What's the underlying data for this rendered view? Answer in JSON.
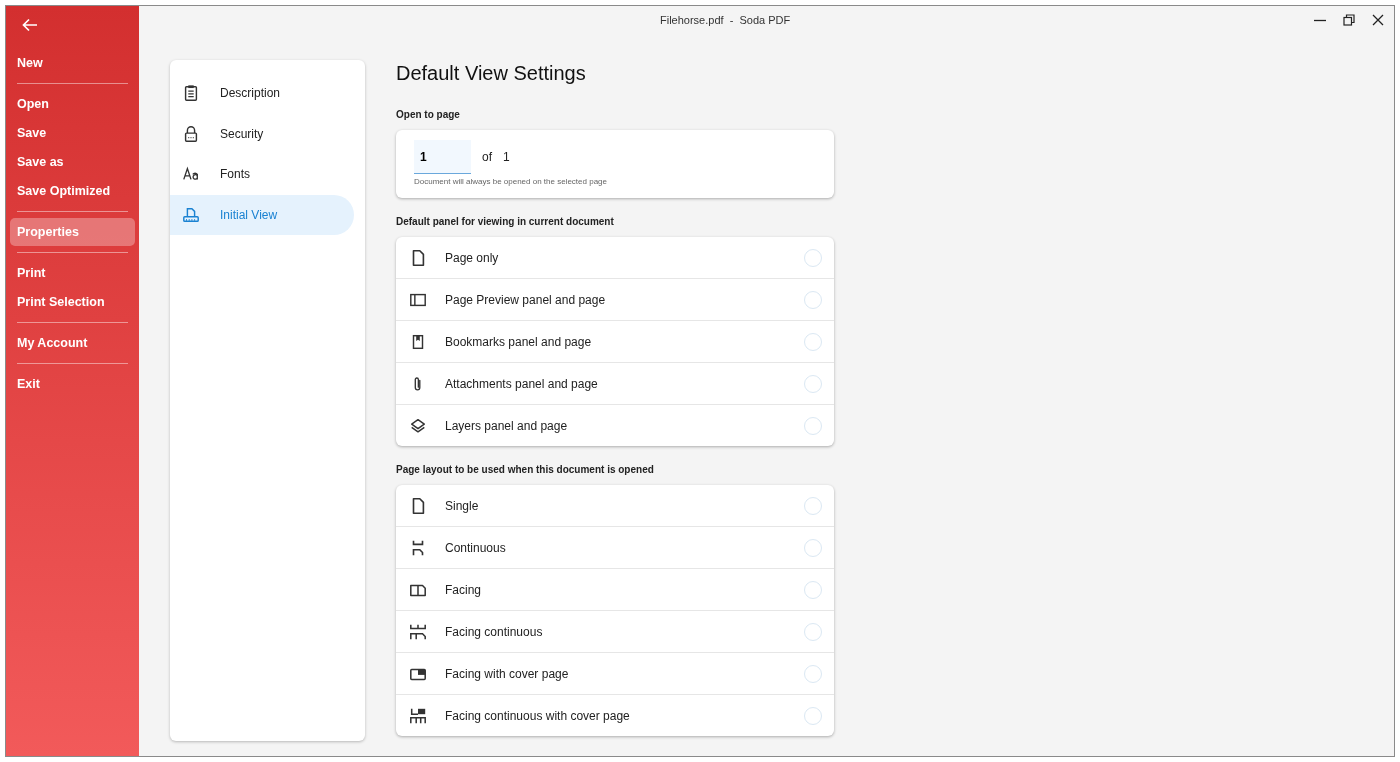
{
  "window": {
    "title": "Filehorse.pdf  -  Soda PDF"
  },
  "sidebar": {
    "groups": [
      {
        "items": [
          {
            "label": "New",
            "selected": false
          }
        ]
      },
      {
        "items": [
          {
            "label": "Open",
            "selected": false
          },
          {
            "label": "Save",
            "selected": false
          },
          {
            "label": "Save as",
            "selected": false
          },
          {
            "label": "Save Optimized",
            "selected": false
          }
        ]
      },
      {
        "items": [
          {
            "label": "Properties",
            "selected": true
          }
        ]
      },
      {
        "items": [
          {
            "label": "Print",
            "selected": false
          },
          {
            "label": "Print Selection",
            "selected": false
          }
        ]
      },
      {
        "items": [
          {
            "label": "My Account",
            "selected": false
          }
        ]
      },
      {
        "items": [
          {
            "label": "Exit",
            "selected": false
          }
        ]
      }
    ]
  },
  "properties_nav": [
    {
      "label": "Description",
      "kind": "clipboard",
      "selected": false
    },
    {
      "label": "Security",
      "kind": "lock",
      "selected": false
    },
    {
      "label": "Fonts",
      "kind": "fonts",
      "selected": false
    },
    {
      "label": "Initial View",
      "kind": "view",
      "selected": true
    }
  ],
  "heading": "Default View Settings",
  "open_to_page": {
    "label": "Open to page",
    "value": "1",
    "of": "of",
    "total": "1",
    "hint": "Document will always be opened on the selected page"
  },
  "panel_section": {
    "label": "Default panel for viewing in current document",
    "options": [
      {
        "label": "Page only",
        "kind": "page",
        "selected": false
      },
      {
        "label": "Page Preview panel and page",
        "kind": "preview",
        "selected": false
      },
      {
        "label": "Bookmarks panel and page",
        "kind": "bookmark",
        "selected": false
      },
      {
        "label": "Attachments panel and page",
        "kind": "clip",
        "selected": false
      },
      {
        "label": "Layers panel and page",
        "kind": "layers",
        "selected": false
      }
    ]
  },
  "layout_section": {
    "label": "Page layout to be used when this document is opened",
    "options": [
      {
        "label": "Single",
        "kind": "page",
        "selected": false
      },
      {
        "label": "Continuous",
        "kind": "continuous",
        "selected": false
      },
      {
        "label": "Facing",
        "kind": "facing",
        "selected": false
      },
      {
        "label": "Facing continuous",
        "kind": "facingcontinuous",
        "selected": false
      },
      {
        "label": "Facing with cover page",
        "kind": "cover",
        "selected": false
      },
      {
        "label": "Facing continuous with cover page",
        "kind": "covercontinuous",
        "selected": false
      }
    ]
  }
}
